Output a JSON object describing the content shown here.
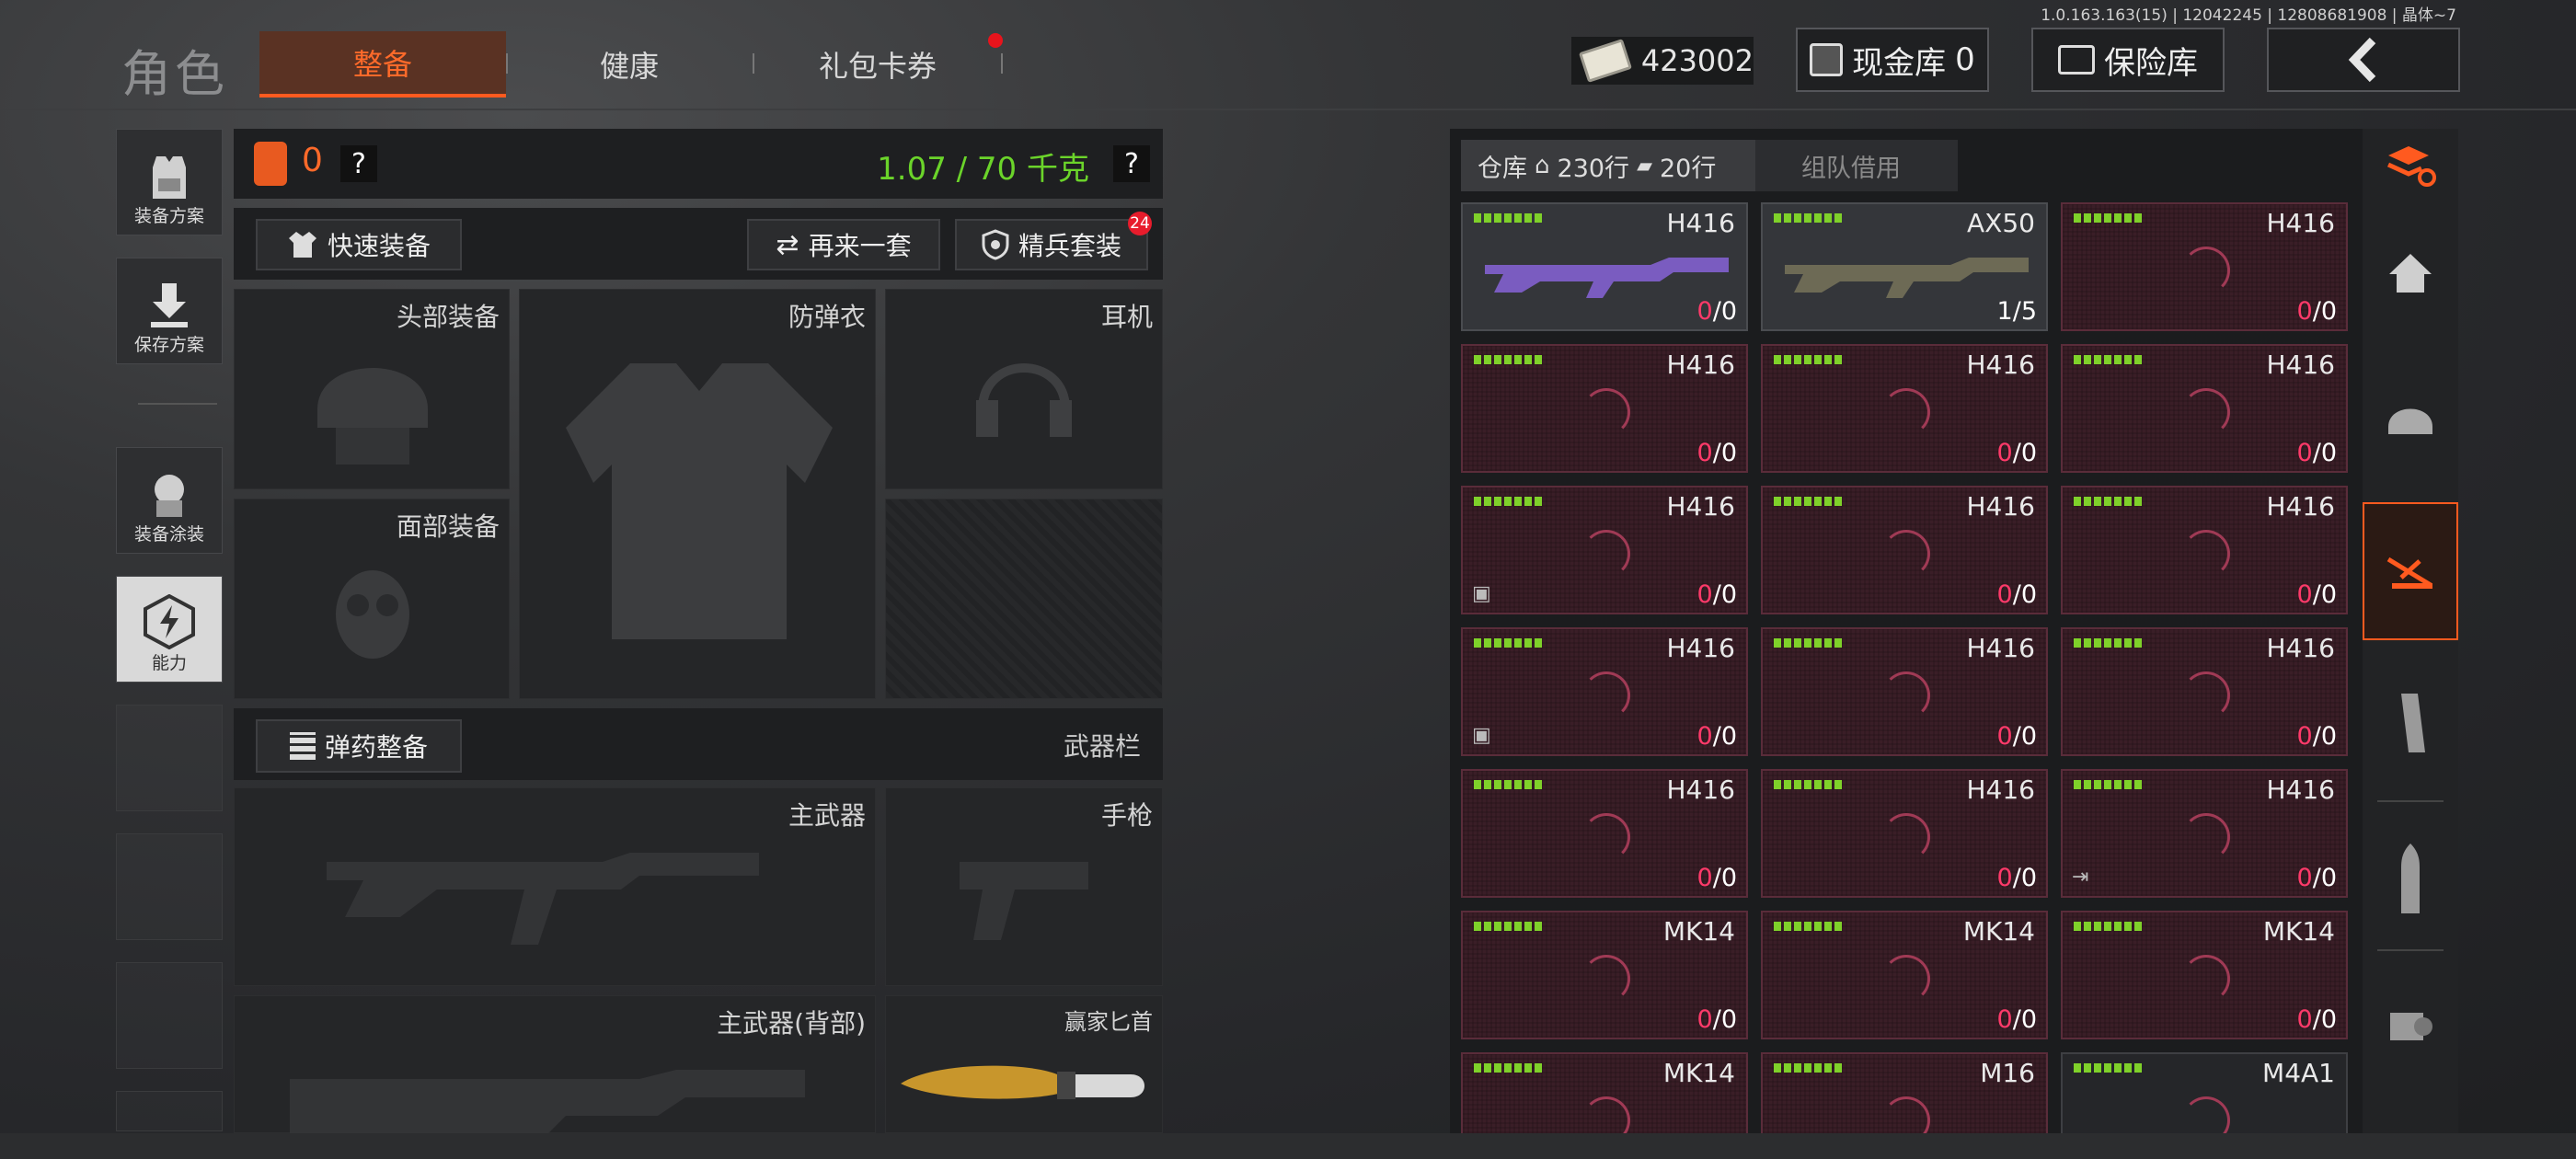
{
  "version_text": "1.0.163.163(15) | 12042245 | 12808681908 | 晶体~7",
  "header": {
    "title": "角色",
    "tabs": [
      {
        "label": "整备",
        "active": true
      },
      {
        "label": "健康",
        "active": false
      },
      {
        "label": "礼包卡券",
        "active": false,
        "notification_dot": true
      }
    ],
    "money": "423002",
    "cash_vault_label": "现金库",
    "cash_vault_count": "0",
    "safe_label": "保险库"
  },
  "left_sidebar": {
    "items": [
      {
        "label": "装备方案",
        "icon": "vest-icon"
      },
      {
        "label": "保存方案",
        "icon": "download-icon"
      },
      {
        "label": "装备涂装",
        "icon": "camo-soldier-icon"
      },
      {
        "label": "能力",
        "icon": "lightning-icon",
        "highlight": true
      }
    ]
  },
  "equipment": {
    "armor_count": "0",
    "help_symbol": "?",
    "weight_text": "1.07 / 70 千克",
    "quick_equip_label": "快速装备",
    "again_label": "再来一套",
    "elite_label": "精兵套装",
    "elite_badge": "24",
    "slots": {
      "head": "头部装备",
      "vest": "防弹衣",
      "headset": "耳机",
      "face": "面部装备"
    },
    "ammo_label": "弹药整备",
    "weapon_bar_label": "武器栏",
    "primary_label": "主武器",
    "pistol_label": "手枪",
    "primary_back_label": "主武器(背部)",
    "melee_label": "赢家匕首"
  },
  "warehouse": {
    "label": "仓库",
    "rows_home": "230行",
    "rows_ticket": "20行",
    "team_borrow_label": "组队借用",
    "items": [
      {
        "name": "H416",
        "count_current": "0",
        "count_total": "0",
        "style": "gray",
        "tag": ""
      },
      {
        "name": "AX50",
        "count_current": "1",
        "count_total": "5",
        "style": "gray",
        "tag": ""
      },
      {
        "name": "H416",
        "count_current": "0",
        "count_total": "0",
        "style": "pink",
        "tag": ""
      },
      {
        "name": "H416",
        "count_current": "0",
        "count_total": "0",
        "style": "pink",
        "tag": ""
      },
      {
        "name": "H416",
        "count_current": "0",
        "count_total": "0",
        "style": "pink",
        "tag": ""
      },
      {
        "name": "H416",
        "count_current": "0",
        "count_total": "0",
        "style": "pink",
        "tag": ""
      },
      {
        "name": "H416",
        "count_current": "0",
        "count_total": "0",
        "style": "pink",
        "tag": "box"
      },
      {
        "name": "H416",
        "count_current": "0",
        "count_total": "0",
        "style": "pink",
        "tag": ""
      },
      {
        "name": "H416",
        "count_current": "0",
        "count_total": "0",
        "style": "pink",
        "tag": ""
      },
      {
        "name": "H416",
        "count_current": "0",
        "count_total": "0",
        "style": "pink",
        "tag": "box"
      },
      {
        "name": "H416",
        "count_current": "0",
        "count_total": "0",
        "style": "pink",
        "tag": ""
      },
      {
        "name": "H416",
        "count_current": "0",
        "count_total": "0",
        "style": "pink",
        "tag": ""
      },
      {
        "name": "H416",
        "count_current": "0",
        "count_total": "0",
        "style": "pink",
        "tag": ""
      },
      {
        "name": "H416",
        "count_current": "0",
        "count_total": "0",
        "style": "pink",
        "tag": ""
      },
      {
        "name": "H416",
        "count_current": "0",
        "count_total": "0",
        "style": "pink",
        "tag": "exit"
      },
      {
        "name": "MK14",
        "count_current": "0",
        "count_total": "0",
        "style": "pink",
        "tag": ""
      },
      {
        "name": "MK14",
        "count_current": "0",
        "count_total": "0",
        "style": "pink",
        "tag": ""
      },
      {
        "name": "MK14",
        "count_current": "0",
        "count_total": "0",
        "style": "pink",
        "tag": ""
      },
      {
        "name": "MK14",
        "count_current": "",
        "count_total": "",
        "style": "pink",
        "tag": ""
      },
      {
        "name": "M16",
        "count_current": "",
        "count_total": "",
        "style": "pink",
        "tag": ""
      },
      {
        "name": "M4A1",
        "count_current": "",
        "count_total": "",
        "style": "dark",
        "tag": ""
      }
    ]
  },
  "right_nav": {
    "items": [
      "layers-refresh-icon",
      "home-icon",
      "helmet-icon",
      "rifle-category-icon",
      "magazine-icon",
      "bullet-icon",
      "scope-icon"
    ],
    "active_index": 3
  },
  "colors": {
    "accent": "#ff5a1f",
    "weight_green": "#6bd42a",
    "count_pink": "#ff3a6a",
    "grade_green": "#7fd12a"
  }
}
